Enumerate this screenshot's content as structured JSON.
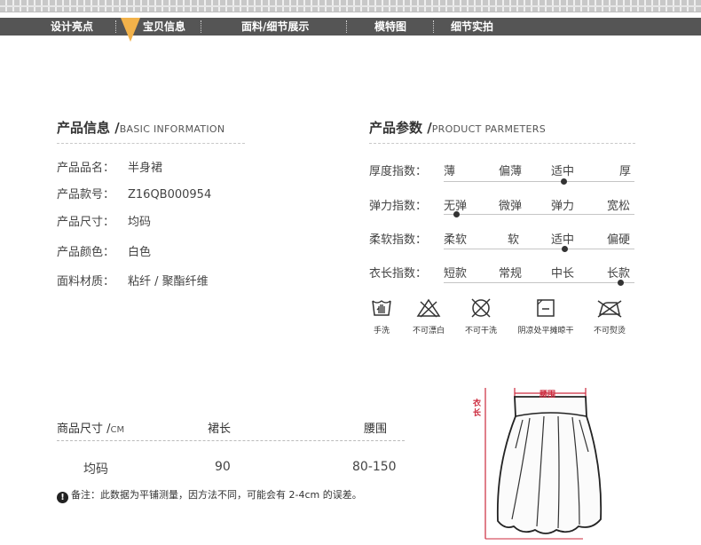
{
  "nav": {
    "items": [
      "设计亮点",
      "宝贝信息",
      "面料/细节展示",
      "模特图",
      "细节实拍"
    ]
  },
  "basic_info": {
    "title": "产品信息 /",
    "title_en": "BASIC INFORMATION",
    "rows": [
      {
        "label": "产品品名：",
        "value": "半身裙"
      },
      {
        "label": "产品款号：",
        "value": "Z16QB000954"
      },
      {
        "label": "产品尺寸：",
        "value": "均码"
      },
      {
        "label": "产品颜色：",
        "value": "白色"
      },
      {
        "label": "面料材质：",
        "value": "粘纤 / 聚酯纤维"
      }
    ]
  },
  "params": {
    "title": "产品参数 /",
    "title_en": "PRODUCT PARMETERS",
    "rows": [
      {
        "label": "厚度指数：",
        "options": [
          "薄",
          "偏薄",
          "适中",
          "厚"
        ],
        "selected_index": 2
      },
      {
        "label": "弹力指数：",
        "options": [
          "无弹",
          "微弹",
          "弹力",
          "宽松"
        ],
        "selected_index": 0
      },
      {
        "label": "柔软指数：",
        "options": [
          "柔软",
          "软",
          "适中",
          "偏硬"
        ],
        "selected_index": 2
      },
      {
        "label": "衣长指数：",
        "options": [
          "短款",
          "常规",
          "中长",
          "长款"
        ],
        "selected_index": 3
      }
    ]
  },
  "care": {
    "items": [
      {
        "icon": "hand-wash-icon",
        "label": "手洗"
      },
      {
        "icon": "no-bleach-icon",
        "label": "不可漂白"
      },
      {
        "icon": "no-dry-clean-icon",
        "label": "不可干洗"
      },
      {
        "icon": "shade-flat-dry-icon",
        "label": "阴凉处平摊晾干"
      },
      {
        "icon": "no-iron-icon",
        "label": "不可熨烫"
      }
    ]
  },
  "size_table": {
    "headers": [
      "商品尺寸 /",
      "裙长",
      "腰围"
    ],
    "unit": "CM",
    "rows": [
      [
        "均码",
        "90",
        "80-150"
      ]
    ]
  },
  "note": "备注：此数据为平铺测量，因方法不同，可能会有 2-4cm 的误差。",
  "diagram": {
    "waist_label": "腰围",
    "length_label": "衣长",
    "accent_color": "#cc2a3d"
  },
  "colors": {
    "nav_bg": "#555555",
    "nav_marker": "#f2b24a"
  }
}
